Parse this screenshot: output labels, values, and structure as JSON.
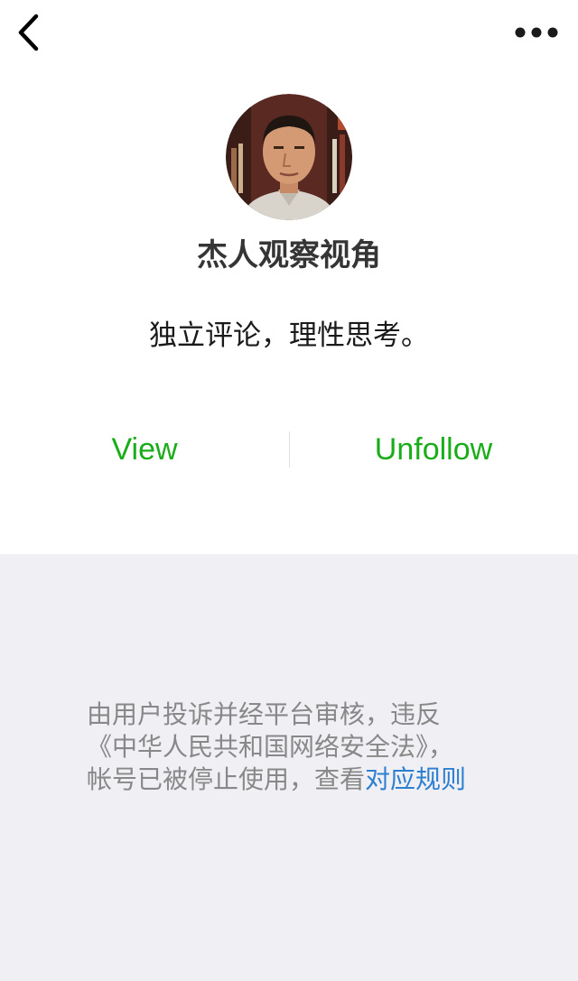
{
  "nav": {
    "back_icon": "chevron-left-icon",
    "more_icon": "ellipsis-icon"
  },
  "profile": {
    "name": "杰人观察视角",
    "intro": "独立评论，理性思考。"
  },
  "actions": {
    "view_label": "View",
    "unfollow_label": "Unfollow"
  },
  "notice": {
    "text": "由用户投诉并经平台审核，违反《中华人民共和国网络安全法》，帐号已被停止使用，查看",
    "link_text": "对应规则"
  },
  "colors": {
    "accent_green": "#1aad19",
    "link_blue": "#2c7fd1",
    "notice_gray": "#888888",
    "bottom_bg": "#efeff4"
  }
}
